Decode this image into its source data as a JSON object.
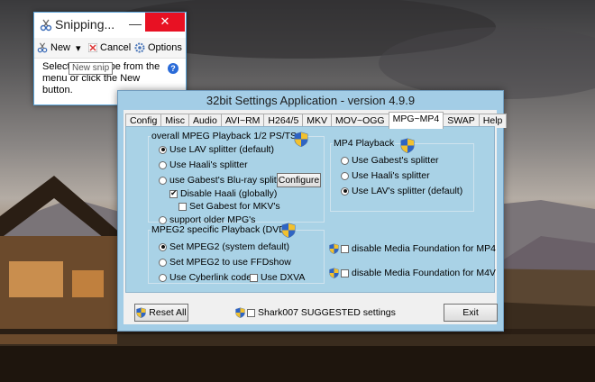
{
  "snipping": {
    "title": "Snipping...",
    "minimize": "—",
    "close": "✕",
    "toolbar": {
      "new_label": "New",
      "new_dropdown": "▾",
      "cancel_label": "Cancel",
      "options_label": "Options"
    },
    "body_text": "Select a snip type from the menu or click the New button.",
    "help": "?",
    "tooltip": "New snip"
  },
  "settings": {
    "title": "32bit Settings Application - version 4.9.9",
    "tabs": [
      {
        "label": "Config"
      },
      {
        "label": "Misc"
      },
      {
        "label": "Audio"
      },
      {
        "label": "AVI~RM"
      },
      {
        "label": "H264/5"
      },
      {
        "label": "MKV"
      },
      {
        "label": "MOV~OGG"
      },
      {
        "label": "MPG~MP4",
        "active": true
      },
      {
        "label": "SWAP"
      },
      {
        "label": "Help"
      }
    ],
    "mpeg12": {
      "title": "overall MPEG Playback 1/2 PS/TS",
      "opt_lav": "Use LAV splitter (default)",
      "opt_haali": "Use Haali's splitter",
      "opt_gabest_bluray": "use Gabest's Blu-ray splitter",
      "configure": "Configure",
      "chk_disable_haali": "Disable Haali (globally)",
      "chk_set_gabest_mkv": "Set Gabest for MKV's",
      "opt_support_older": "support older MPG's"
    },
    "mp4": {
      "title": "MP4 Playback",
      "opt_gabest": "Use Gabest's splitter",
      "opt_haali": "Use Haali's splitter",
      "opt_lav": "Use LAV's splitter (default)"
    },
    "mpeg2": {
      "title": "MPEG2 specific Playback (DVD)",
      "opt_set_mpeg2": "Set MPEG2 (system default)",
      "opt_ffdshow": "Set MPEG2 to use FFDshow",
      "opt_cyberlink": "Use Cyberlink codec",
      "chk_dxva": "Use DXVA"
    },
    "mf": {
      "mp4": "disable Media Foundation for MP4",
      "m4v": "disable Media Foundation for M4V"
    },
    "bottom": {
      "reset_all": "Reset All",
      "suggested": "Shark007 SUGGESTED settings",
      "exit": "Exit"
    }
  }
}
